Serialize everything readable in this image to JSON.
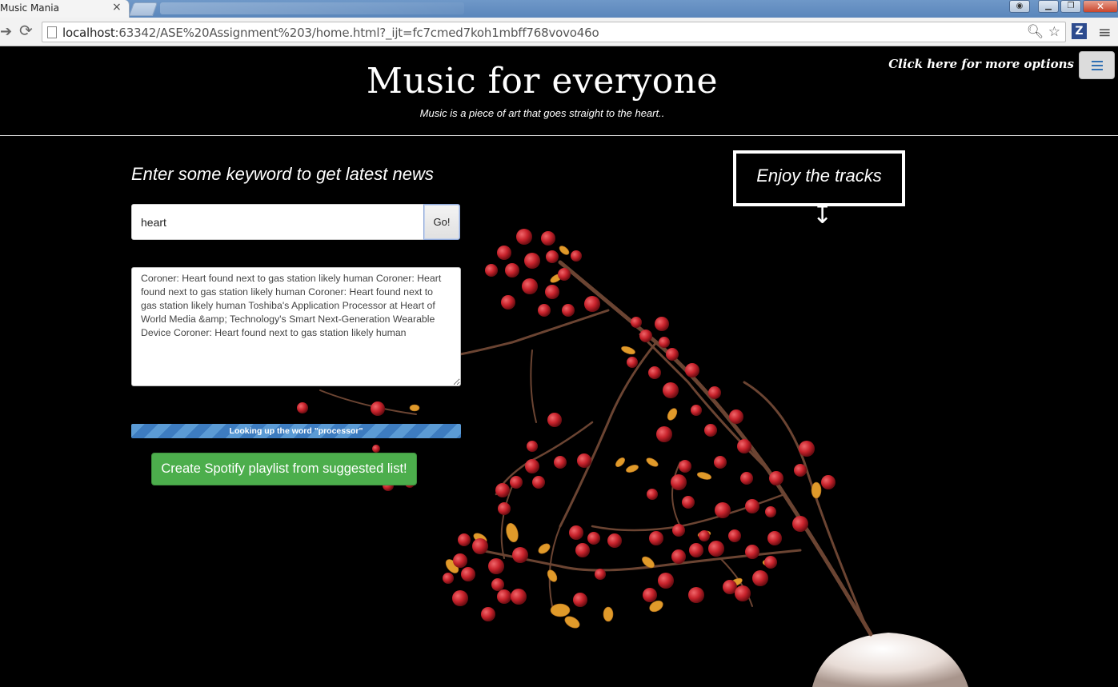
{
  "browser": {
    "tab_title": "Music Mania",
    "tab_close": "×",
    "url_host": "localhost",
    "url_rest": ":63342/ASE%20Assignment%203/home.html?_ijt=fc7cmed7koh1mbff768vovo46o",
    "back_icon": "arrow-back-icon",
    "reload_icon": "reload-icon",
    "zoom_icon": "magnifier-icon",
    "star_icon": "star-icon",
    "extension_label": "Z",
    "menu_icon": "hamburger-icon"
  },
  "header": {
    "title": "Music for everyone",
    "tagline": "Music is a piece of art that goes straight to the heart..",
    "more_options": "Click here for more options"
  },
  "news": {
    "heading": "Enter some keyword to get latest news",
    "search_value": "heart",
    "go_label": "Go!",
    "results": "Coroner: Heart found next to gas station likely human Coroner: Heart found next to gas station likely human Coroner: Heart found next to gas station likely human Toshiba's Application Processor at Heart of World Media &amp; Technology's Smart Next-Generation Wearable Device Coroner: Heart found next to gas station likely human",
    "progress_label": "Looking up the word \"processor\"",
    "spotify_button": "Create Spotify playlist from suggested list!"
  },
  "tracks": {
    "label": "Enjoy the tracks",
    "arrow": "↧"
  },
  "colors": {
    "page_background": "#000000",
    "progress_blue": "#5b9bd5",
    "spotify_green": "#4cae4c",
    "berry_red": "#c8232c",
    "leaf_orange": "#e09a2a"
  }
}
